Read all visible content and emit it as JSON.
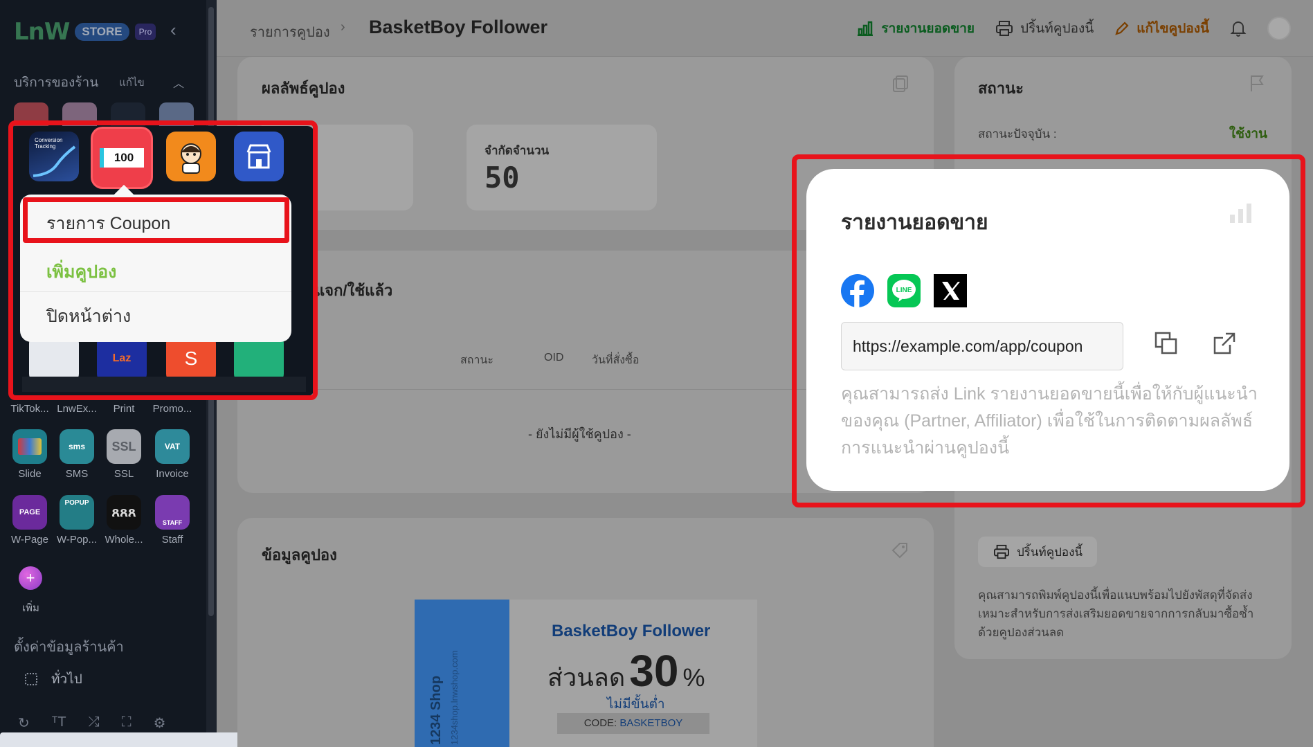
{
  "header": {
    "breadcrumb_parent": "รายการคูปอง",
    "breadcrumb_sep": "›",
    "title": "BasketBoy Follower",
    "sales_report": "รายงานยอดขาย",
    "print_coupon": "ปริ้นท์คูปองนี้",
    "edit_coupon": "แก้ไขคูปองนี้"
  },
  "sidebar": {
    "logo_text": "LnW",
    "store_badge": "STORE",
    "pro_badge": "Pro",
    "section_title": "บริการของร้าน",
    "section_edit": "แก้ไข",
    "apps_row1": [
      {
        "label": "TikTok...",
        "color": "#1b1b1b"
      },
      {
        "label": "LnwEx...",
        "color": "#1b1b1b"
      },
      {
        "label": "Print",
        "color": "#1b1b1b"
      },
      {
        "label": "Promo...",
        "color": "#1b1b1b"
      }
    ],
    "apps_row2": [
      {
        "label": "Slide",
        "icon_text": "",
        "color": "#1e7e8c"
      },
      {
        "label": "SMS",
        "icon_text": "sms",
        "color": "#2a8a96"
      },
      {
        "label": "SSL",
        "icon_text": "SSL",
        "color": "#a7aab0"
      },
      {
        "label": "Invoice",
        "icon_text": "VAT",
        "color": "#2e8a9a"
      }
    ],
    "apps_row3": [
      {
        "label": "W-Page",
        "icon_text": "PAGE",
        "color": "#6b2a9c"
      },
      {
        "label": "W-Pop...",
        "icon_text": "POPUP",
        "color": "#237d86"
      },
      {
        "label": "Whole...",
        "icon_text": "",
        "color": "#111111"
      },
      {
        "label": "Staff",
        "icon_text": "STAFF",
        "color": "#7a3bb0"
      }
    ],
    "add_label": "เพิ่ม",
    "settings_section": "ตั้งค่าข้อมูลร้านค้า",
    "general_item": "ทั่วไป"
  },
  "popup_apps": {
    "apps": [
      {
        "name": "conversion-tracking",
        "text": "Conversion Tracking",
        "color": "#1a2a52"
      },
      {
        "name": "coupon",
        "text": "100",
        "color": "#ee3b48"
      },
      {
        "name": "mascot",
        "text": "",
        "color": "#f28a1c"
      },
      {
        "name": "shop",
        "text": "",
        "color": "#3059c8"
      }
    ],
    "bottom_apps": [
      {
        "name": "notes",
        "text": "",
        "color": "#e6e9ee"
      },
      {
        "name": "lazada",
        "text": "Laz",
        "color": "#1d2ea0"
      },
      {
        "name": "shopee",
        "text": "S",
        "color": "#ee4d2d"
      },
      {
        "name": "bag",
        "text": "",
        "color": "#22b07a"
      }
    ]
  },
  "menu": {
    "items": [
      "รายการ Coupon",
      "เพิ่มคูปอง",
      "ปิดหน้าต่าง"
    ]
  },
  "results_card": {
    "title": "ผลลัพธ์คูปอง",
    "limit_label": "จำกัดจำนวน",
    "limit_value": "50",
    "used_title_partial": "แจก/ใช้แล้ว",
    "col_status": "สถานะ",
    "col_oid": "OID",
    "col_date": "วันที่สั่งซื้อ",
    "empty": "- ยังไม่มีผู้ใช้คูปอง -"
  },
  "status_card": {
    "title": "สถานะ",
    "current_label": "สถานะปัจจุบัน :",
    "current_value": "ใช้งาน"
  },
  "info_card": {
    "title": "ข้อมูลคูปอง"
  },
  "coupon": {
    "shop": "1234 Shop",
    "shop_url": "1234shop.lnwshop.com",
    "name": "BasketBoy Follower",
    "discount_prefix": "ส่วนลด",
    "discount_value": "30",
    "discount_unit": "%",
    "min": "ไม่มีขั้นต่ำ",
    "code_label": "CODE:",
    "code_value": "BASKETBOY"
  },
  "print_panel": {
    "button": "ปริ้นท์คูปองนี้",
    "description": "คุณสามารถพิมพ์คูปองนี้เพื่อแนบพร้อมไปยังพัสดุที่จัดส่ง เหมาะสำหรับการส่งเสริมยอดขายจากการกลับมาซื้อซ้ำด้วยคูปองส่วนลด"
  },
  "share": {
    "title": "รายงานยอดขาย",
    "url": "https://example.com/app/coupon",
    "description": "คุณสามารถส่ง Link รายงานยอดขายนี้เพื่อให้กับผู้แนะนำของคุณ (Partner, Affiliator) เพื่อใช้ในการติดตามผลลัพธ์การแนะนำผ่านคูปองนี้"
  },
  "colors": {
    "highlight": "#e8131b",
    "green_active": "#7cc142",
    "facebook": "#1877f2",
    "line": "#06c755"
  }
}
